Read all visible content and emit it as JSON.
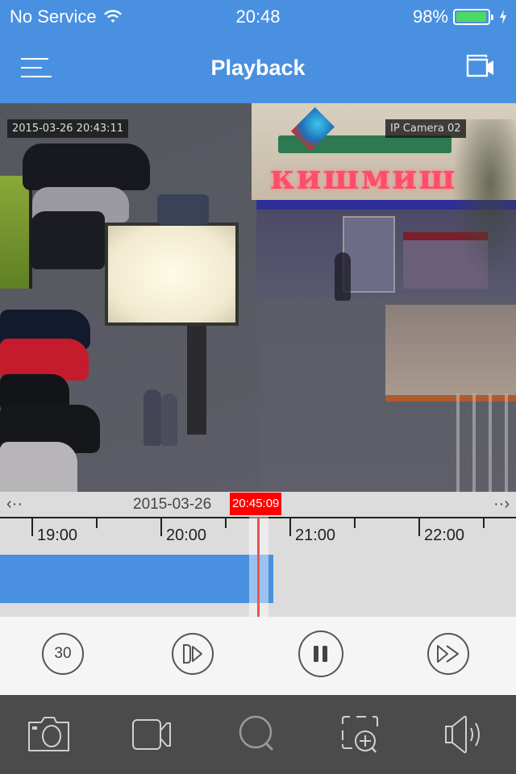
{
  "status_bar": {
    "carrier": "No Service",
    "time": "20:48",
    "battery_percent": "98%",
    "battery_level": 0.98,
    "charging": true
  },
  "nav": {
    "title": "Playback",
    "left_icon": "menu-icon",
    "right_icon": "camera-switch-icon"
  },
  "video": {
    "timestamp_overlay": "2015-03-26 20:43:11",
    "camera_name": "IP Camera 02"
  },
  "timeline": {
    "prev_label": "‹··",
    "next_label": "··›",
    "date": "2015-03-26",
    "current_time": "20:45:09",
    "hour_labels": [
      "19:00",
      "20:00",
      "21:00",
      "22:00"
    ],
    "visible_range_hours": [
      18.75,
      22.75
    ],
    "recording_segments": [
      {
        "start": "18:45",
        "end": "20:52"
      }
    ],
    "playhead_time": "20:45:09",
    "accent_color": "#4a90e0",
    "playhead_color": "#ff0000"
  },
  "controls": {
    "rewind_seconds_label": "30",
    "items": [
      {
        "name": "rewind-30-button",
        "icon": "rewind-30-icon"
      },
      {
        "name": "step-forward-button",
        "icon": "frame-forward-icon"
      },
      {
        "name": "pause-button",
        "icon": "pause-icon"
      },
      {
        "name": "fast-forward-button",
        "icon": "fast-forward-icon"
      }
    ]
  },
  "toolbar": {
    "items": [
      {
        "name": "snapshot-button",
        "icon": "camera-icon"
      },
      {
        "name": "record-button",
        "icon": "video-camera-icon"
      },
      {
        "name": "search-button",
        "icon": "search-icon"
      },
      {
        "name": "digital-zoom-button",
        "icon": "zoom-in-icon"
      },
      {
        "name": "audio-button",
        "icon": "speaker-icon"
      }
    ]
  }
}
